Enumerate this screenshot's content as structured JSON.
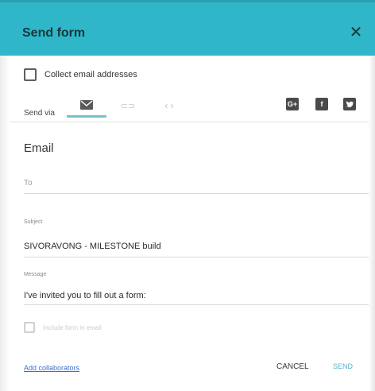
{
  "header": {
    "title": "Send form",
    "close_glyph": "✕",
    "bg_color": "#2fb7c9"
  },
  "collect_email": {
    "label": "Collect email addresses",
    "checked": false
  },
  "send_via": {
    "label": "Send via",
    "tabs": [
      {
        "name": "email",
        "icon": "mail-icon",
        "selected": true
      },
      {
        "name": "link",
        "icon": "link-icon",
        "glyph": "⊂⊃",
        "selected": false
      },
      {
        "name": "embed",
        "icon": "embed-code-icon",
        "glyph": "‹ ›",
        "selected": false
      }
    ],
    "social": [
      {
        "icon": "google-plus-icon",
        "glyph": "G+"
      },
      {
        "icon": "facebook-icon",
        "glyph": "f"
      },
      {
        "icon": "twitter-icon",
        "glyph": ""
      }
    ]
  },
  "email_section": {
    "title": "Email",
    "to": {
      "placeholder": "To",
      "value": ""
    },
    "subject": {
      "label": "Subject",
      "value": "SIVORAVONG - MILESTONE build"
    },
    "message": {
      "label": "Message",
      "value": "I've invited you to fill out a form:"
    },
    "include_form": {
      "label": "Include form in email",
      "checked": false,
      "disabled": true
    }
  },
  "footer": {
    "add_collaborators": "Add collaborators",
    "cancel": "CANCEL",
    "send": "SEND"
  }
}
